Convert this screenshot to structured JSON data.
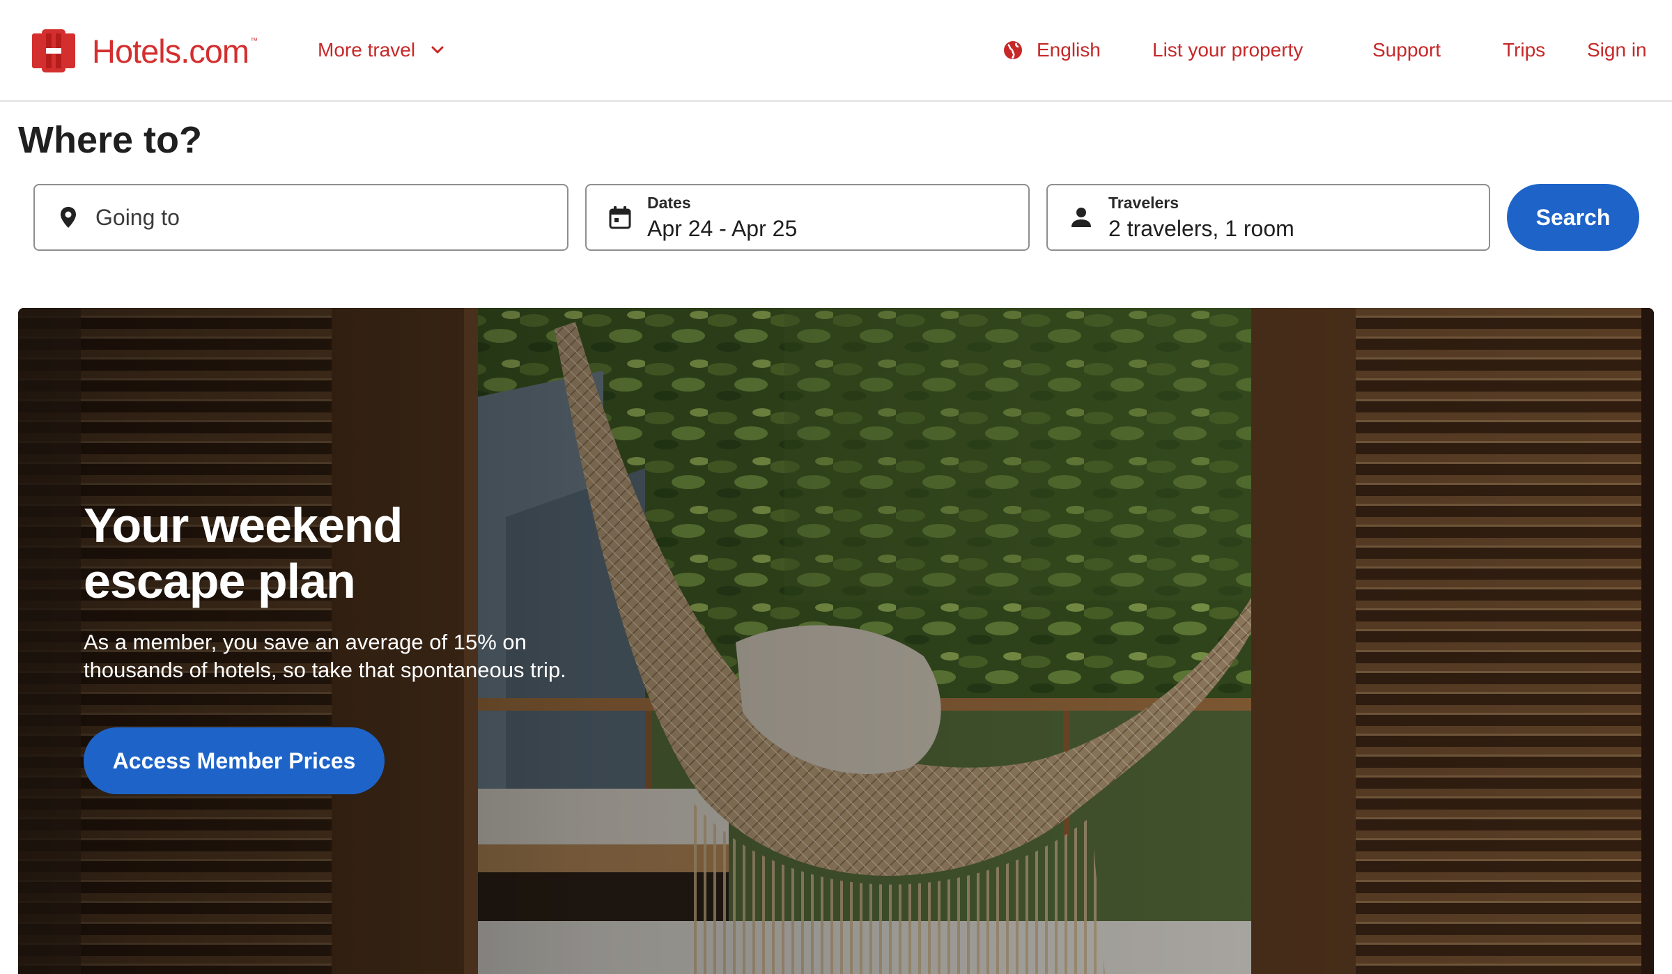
{
  "header": {
    "brand": "Hotels.com",
    "brand_tm": "™",
    "more_travel": "More travel",
    "language": "English",
    "list_property": "List your property",
    "support": "Support",
    "trips": "Trips",
    "sign_in": "Sign in"
  },
  "search": {
    "heading": "Where to?",
    "destination_placeholder": "Going to",
    "dates_label": "Dates",
    "dates_value": "Apr 24 - Apr 25",
    "travelers_label": "Travelers",
    "travelers_value": "2 travelers, 1 room",
    "search_button": "Search"
  },
  "hero": {
    "title_line1": "Your weekend",
    "title_line2": "escape plan",
    "description": "As a member, you save an average of 15% on thousands of hotels, so take that spontaneous trip.",
    "cta": "Access Member Prices"
  },
  "icons": {
    "logo": "hotels-logo-icon",
    "chevron": "chevron-down-icon",
    "globe": "globe-icon",
    "pin": "location-pin-icon",
    "calendar": "calendar-icon",
    "person": "person-icon"
  },
  "colors": {
    "brand_red": "#d32f2f",
    "primary_blue": "#1e64c8",
    "field_border": "#8e8e8e"
  }
}
